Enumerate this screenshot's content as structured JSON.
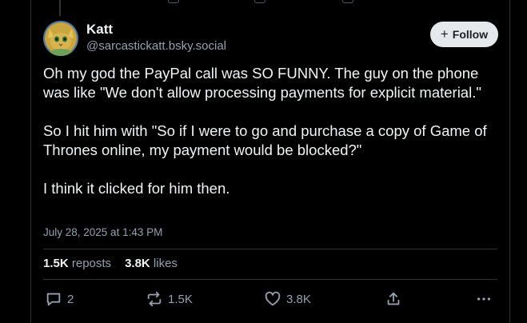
{
  "post": {
    "author": {
      "name": "Katt",
      "handle": "@sarcastickatt.bsky.social"
    },
    "follow_label": "Follow",
    "paragraphs": [
      "Oh my god the PayPal call was SO FUNNY. The guy on the phone was like \"We don't allow processing payments for explicit material.\"",
      "So I hit him with \"So if I were to go and purchase a copy of Game of Thrones online, my payment would be blocked?\"",
      "I think it clicked for him then."
    ],
    "timestamp": "July 28, 2025 at 1:43 PM",
    "stats": {
      "reposts_count": "1.5K",
      "reposts_label": "reposts",
      "likes_count": "3.8K",
      "likes_label": "likes"
    },
    "actions": {
      "reply_count": "2",
      "repost_count": "1.5K",
      "like_count": "3.8K"
    }
  },
  "icons": [
    "speech-bubble-icon",
    "repost-icon",
    "heart-icon",
    "share-icon",
    "more-icon",
    "plus-icon"
  ],
  "colors": {
    "background": "#000000",
    "text": "#f1f3f5",
    "muted": "#93a1b0",
    "border": "#2e3338",
    "follow_bg": "#e6e9ec"
  }
}
